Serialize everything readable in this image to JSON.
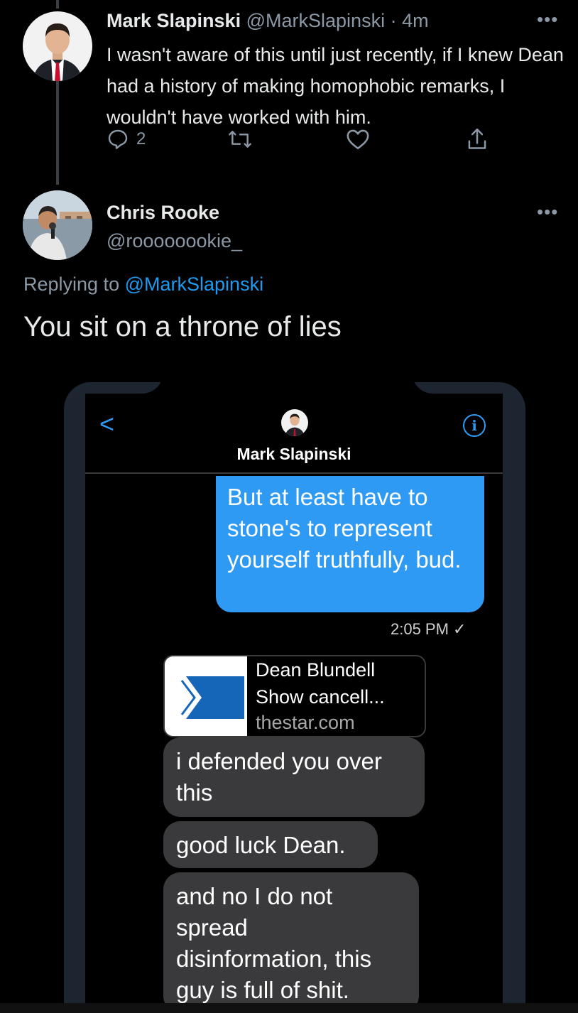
{
  "tweet1": {
    "name": "Mark Slapinski",
    "handle": "@MarkSlapinski",
    "time": "· 4m",
    "text": "I wasn't aware of this until just recently, if I knew Dean had a history of making homophobic remarks, I wouldn't have worked with him.",
    "reply_count": "2",
    "more": "•••"
  },
  "tweet2": {
    "name": "Chris Rooke",
    "handle": "@roooooookie_",
    "replying_prefix": "Replying to",
    "replying_handle": "@MarkSlapinski",
    "text": "You sit on a throne of lies",
    "more": "•••"
  },
  "screenshot": {
    "contact_name": "Mark Slapinski",
    "back_glyph": "<",
    "info_glyph": "i",
    "outgoing_message": "But at least have to stone's to represent yourself truthfully, bud.",
    "outgoing_time": "2:05 PM ✓",
    "link_title": "Dean Blundell Show cancell...",
    "link_domain": "thestar.com",
    "incoming": [
      "i defended you over this",
      "good luck Dean.",
      "and no I do not spread disinformation, this guy is full of shit."
    ]
  },
  "colors": {
    "background": "#000000",
    "link_blue": "#1d9bf0",
    "imessage_blue": "#2f9af4",
    "incoming_gray": "#3a3a3c"
  }
}
